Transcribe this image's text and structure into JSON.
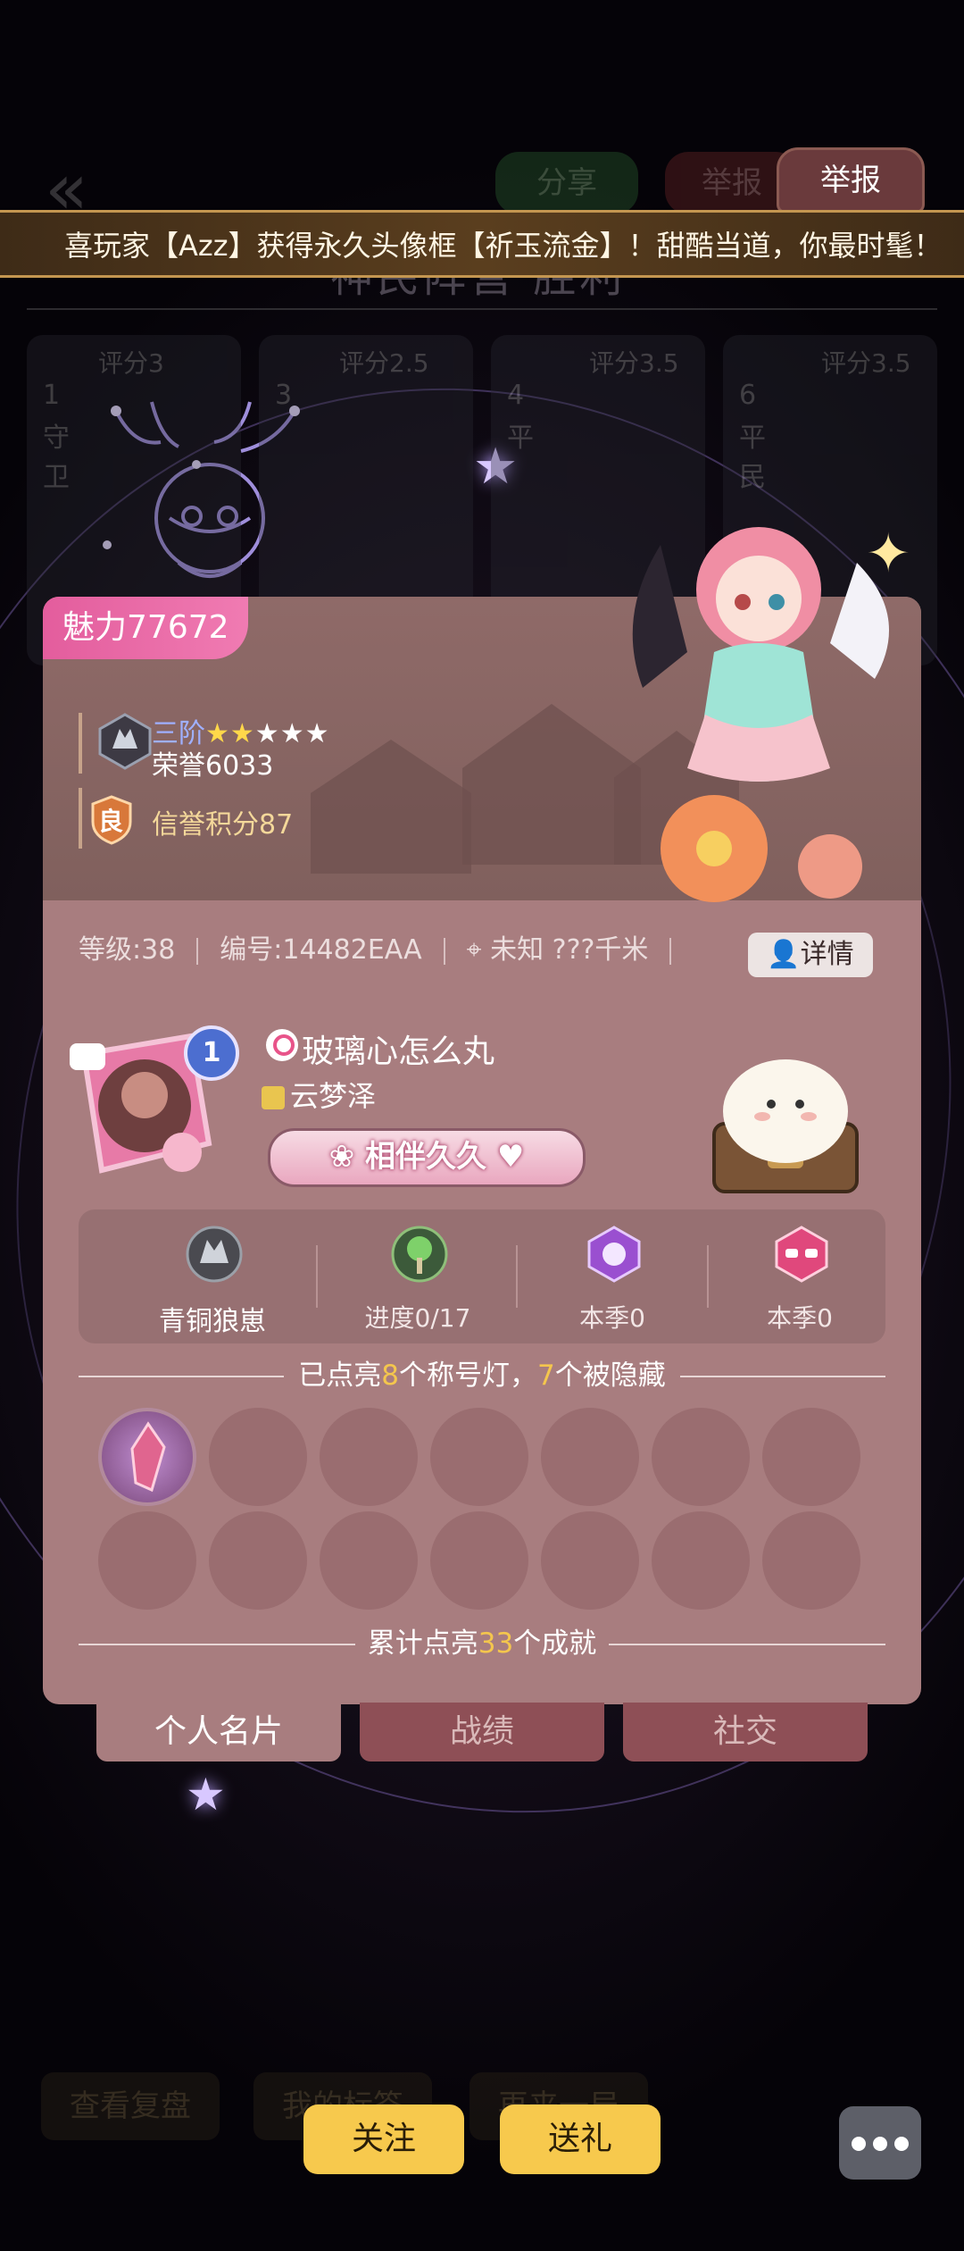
{
  "top_nav": {
    "back_glyph": "«",
    "share_label": "分享",
    "report_ghost_label": "举报",
    "game_result": "神民阵营 胜利",
    "players": [
      {
        "seat": "1",
        "role": "守卫",
        "score": "评分3"
      },
      {
        "seat": "3",
        "role": "",
        "score": "评分2.5"
      },
      {
        "seat": "4",
        "role": "平",
        "score": "评分3.5"
      },
      {
        "seat": "6",
        "role": "平民",
        "score": "评分3.5"
      }
    ]
  },
  "report_button": {
    "label": "举报"
  },
  "marquee": {
    "text": "喜玩家【Azz】获得永久头像框【祈玉流金】！甜酷当道，你最时髦！"
  },
  "profile": {
    "charm_label": "魅力",
    "charm_value": "77672",
    "rank_title": "三阶",
    "rank_stars_filled": "★★",
    "rank_stars_empty": "★★★",
    "honor": "荣誉6033",
    "reputation_badge": "良",
    "reputation": "信誉积分87",
    "level": "等级:38",
    "id": "编号:14482EAA",
    "location": "未知 ???千米",
    "detail_button": "详情",
    "avatar_level": "1",
    "nickname": "玻璃心怎么丸",
    "guild": "云梦泽",
    "companion_label": "相伴久久",
    "stats": [
      {
        "label": "青铜狼崽",
        "icon": "wolf-icon"
      },
      {
        "label": "进度0/17",
        "icon": "tree-icon"
      },
      {
        "label": "本季0",
        "icon": "rose-icon"
      },
      {
        "label": "本季0",
        "icon": "glasses-icon"
      }
    ],
    "titles_prefix": "已点亮",
    "titles_lit": "8",
    "titles_mid": "个称号灯，",
    "titles_hidden": "7",
    "titles_suffix": "个被隐藏",
    "achievement_prefix": "累计点亮",
    "achievement_count": "33",
    "achievement_suffix": "个成就"
  },
  "tabs": [
    {
      "label": "个人名片",
      "active": true
    },
    {
      "label": "战绩",
      "active": false
    },
    {
      "label": "社交",
      "active": false
    }
  ],
  "bottom": {
    "ghost_buttons": [
      "查看复盘",
      "我的标签",
      "再来一局"
    ],
    "follow_label": "关注",
    "gift_label": "送礼"
  },
  "colors": {
    "accent_pink": "#e35d9d",
    "card": "#a87d7f",
    "button_yellow": "#f7c94d",
    "highlight": "#f4c64d"
  }
}
